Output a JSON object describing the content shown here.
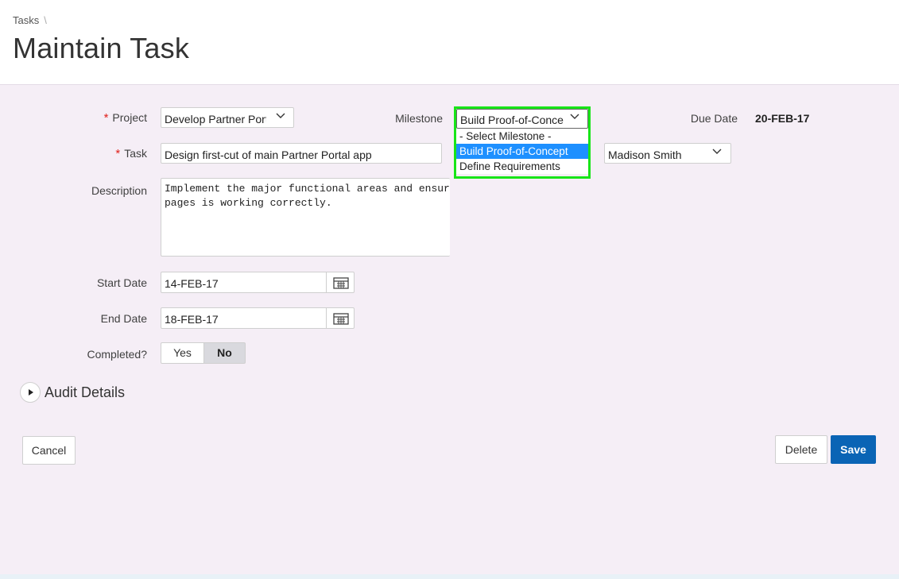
{
  "breadcrumb": {
    "items": [
      "Tasks"
    ],
    "separator": "\\"
  },
  "page": {
    "title": "Maintain Task"
  },
  "form": {
    "project": {
      "label": "Project",
      "value": "Develop Partner Portal"
    },
    "milestone": {
      "label": "Milestone",
      "value": "Build Proof-of-Concept",
      "options": [
        "- Select Milestone -",
        "Build Proof-of-Concept",
        "Define Requirements"
      ],
      "selected_index": 1
    },
    "due_date": {
      "label": "Due Date",
      "value": "20-FEB-17"
    },
    "task": {
      "label": "Task",
      "value": "Design first-cut of main Partner Portal app"
    },
    "assignee": {
      "value": "Madison Smith"
    },
    "description": {
      "label": "Description",
      "value": "Implement the major functional areas and ensure navigation between\npages is working correctly."
    },
    "start_date": {
      "label": "Start Date",
      "value": "14-FEB-17"
    },
    "end_date": {
      "label": "End Date",
      "value": "18-FEB-17"
    },
    "completed": {
      "label": "Completed?",
      "yes_label": "Yes",
      "no_label": "No",
      "value": "No"
    }
  },
  "audit": {
    "label": "Audit Details"
  },
  "buttons": {
    "cancel": "Cancel",
    "delete": "Delete",
    "save": "Save"
  },
  "colors": {
    "accent": "#0a64b5",
    "highlight": "#18e518",
    "selected_option": "#1e90ff",
    "background": "#f5eef6"
  },
  "icons": {
    "calendar": "calendar-icon",
    "chevron": "chevron-down-icon",
    "expand": "play-triangle-icon"
  }
}
